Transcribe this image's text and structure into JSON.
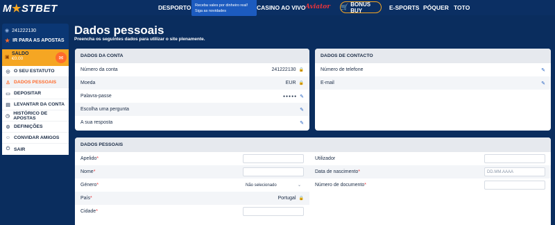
{
  "brand": {
    "logo_text_a": "M",
    "logo_star": "★",
    "logo_text_b": "STBET"
  },
  "nav": {
    "desporto": "DESPORTO",
    "casino_ao_vivo": "CASINO AO VIVO",
    "aviator": "Aviator",
    "bonus_buy": "BONUS BUY",
    "esports": "E-SPORTS",
    "poquer": "PÓQUER",
    "toto": "TOTO"
  },
  "promo": {
    "line1": "Receba vales por dinheiro real!",
    "line2": "Siga as novidades"
  },
  "sidebar": {
    "account_id": "241222130",
    "bets_link": "IR PARA AS APOSTAS",
    "saldo_label": "SALDO",
    "saldo_value": "€0.00",
    "items": [
      {
        "label": "O SEU ESTATUTO",
        "icon": "status-icon"
      },
      {
        "label": "DADOS PESSOAIS",
        "icon": "user-icon"
      },
      {
        "label": "DEPOSITAR",
        "icon": "deposit-icon"
      },
      {
        "label": "LEVANTAR DA CONTA",
        "icon": "withdraw-icon"
      },
      {
        "label": "HISTÓRICO DE APOSTAS",
        "icon": "history-icon"
      },
      {
        "label": "DEFINIÇÕES",
        "icon": "settings-icon"
      },
      {
        "label": "CONVIDAR AMIGOS",
        "icon": "invite-icon"
      },
      {
        "label": "SAIR",
        "icon": "logout-icon"
      }
    ]
  },
  "page": {
    "title": "Dados pessoais",
    "subtitle": "Preencha os seguintes dados para utilizar o site plenamente."
  },
  "account_card": {
    "header": "DADOS DA CONTA",
    "rows": [
      {
        "label": "Número da conta",
        "value": "241222130"
      },
      {
        "label": "Moeda",
        "value": "EUR"
      },
      {
        "label": "Palavra-passe",
        "value": "●●●●●"
      },
      {
        "label": "Escolha uma pergunta",
        "value": ""
      },
      {
        "label": "A sua resposta",
        "value": ""
      }
    ]
  },
  "contact_card": {
    "header": "DADOS DE CONTACTO",
    "rows": [
      {
        "label": "Número de telefone"
      },
      {
        "label": "E-mail"
      }
    ]
  },
  "personal_card": {
    "header": "DADOS PESSOAIS",
    "left": [
      {
        "label": "Apelido",
        "required": "*",
        "value": ""
      },
      {
        "label": "Nome",
        "required": "*",
        "value": ""
      },
      {
        "label": "Género",
        "required": "*",
        "value": "Não selecionado"
      },
      {
        "label": "País",
        "required": "*",
        "value": "Portugal"
      },
      {
        "label": "Cidade",
        "required": "*",
        "value": ""
      }
    ],
    "right": [
      {
        "label": "Utilizador",
        "required": "",
        "value": ""
      },
      {
        "label": "Data de nascimento",
        "required": "*",
        "placeholder": "DD.MM.AAAA"
      },
      {
        "label": "Número de documento",
        "required": "*",
        "value": ""
      }
    ]
  },
  "colors": {
    "navy": "#0a2d5e",
    "accent_orange": "#ff6b2c",
    "saldo_yellow": "#f5a623",
    "link_blue": "#1c5bbf"
  }
}
